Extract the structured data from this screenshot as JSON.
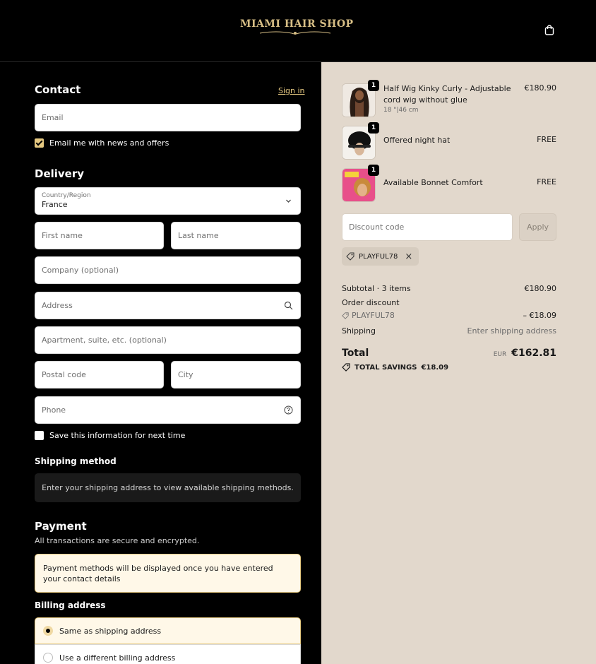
{
  "header": {
    "logo_text": "MIAMI HAIR SHOP",
    "cart_icon": "shopping-bag-icon"
  },
  "contact": {
    "title": "Contact",
    "signin": "Sign in",
    "email_placeholder": "Email",
    "newsletter_label": "Email me with news and offers",
    "newsletter_checked": true
  },
  "delivery": {
    "title": "Delivery",
    "country_label": "Country/Region",
    "country_value": "France",
    "first_name": "First name",
    "last_name": "Last name",
    "company": "Company (optional)",
    "address": "Address",
    "apartment": "Apartment, suite, etc. (optional)",
    "postal": "Postal code",
    "city": "City",
    "phone": "Phone",
    "save_info": "Save this information for next time"
  },
  "shipping": {
    "title": "Shipping method",
    "message": "Enter your shipping address to view available shipping methods."
  },
  "payment": {
    "title": "Payment",
    "subtitle": "All transactions are secure and encrypted.",
    "notice": "Payment methods will be displayed once you have entered your contact details"
  },
  "billing": {
    "title": "Billing address",
    "options": [
      {
        "label": "Same as shipping address",
        "selected": true
      },
      {
        "label": "Use a different billing address",
        "selected": false
      }
    ]
  },
  "summary": {
    "items": [
      {
        "name": "Half Wig Kinky Curly - Adjustable cord wig without glue",
        "variant": "18 \"|46 cm",
        "price": "€180.90",
        "qty": "1"
      },
      {
        "name": "Offered night hat",
        "variant": "",
        "price": "FREE",
        "qty": "1"
      },
      {
        "name": "Available Bonnet Comfort",
        "variant": "",
        "price": "FREE",
        "qty": "1"
      }
    ],
    "discount_placeholder": "Discount code",
    "apply_label": "Apply",
    "applied_code": "PLAYFUL78",
    "subtotal_label": "Subtotal · 3 items",
    "subtotal_value": "€180.90",
    "order_discount_label": "Order discount",
    "discount_code": "PLAYFUL78",
    "discount_value": "– €18.09",
    "shipping_label": "Shipping",
    "shipping_value": "Enter shipping address",
    "total_label": "Total",
    "currency": "EUR",
    "total_value": "€162.81",
    "savings_label": "TOTAL SAVINGS",
    "savings_value": "€18.09"
  },
  "colors": {
    "accent": "#e6c981",
    "summary_bg": "#e2d8cc",
    "page_bg": "#000000"
  }
}
